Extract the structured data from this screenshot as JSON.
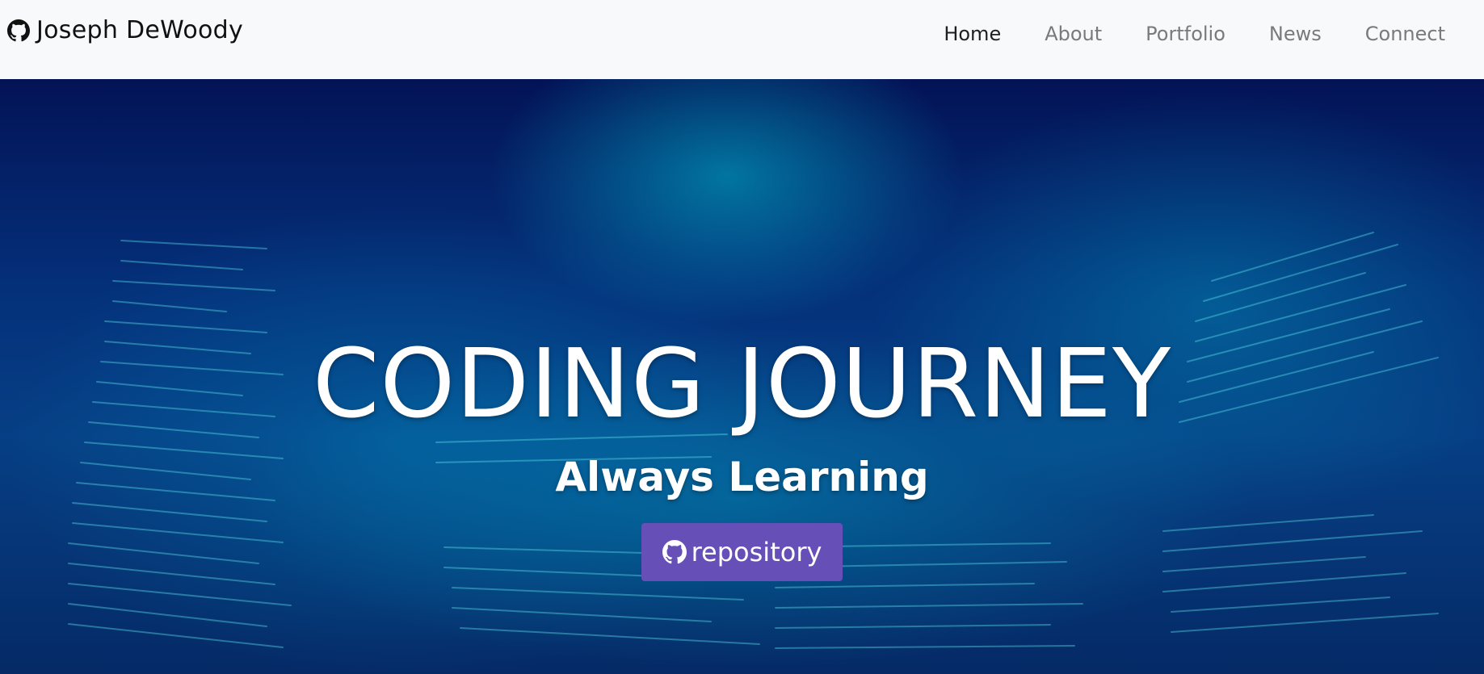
{
  "brand": {
    "name": "Joseph DeWoody",
    "icon": "github-icon"
  },
  "nav": {
    "items": [
      {
        "label": "Home",
        "active": true
      },
      {
        "label": "About",
        "active": false
      },
      {
        "label": "Portfolio",
        "active": false
      },
      {
        "label": "News",
        "active": false
      },
      {
        "label": "Connect",
        "active": false
      }
    ]
  },
  "hero": {
    "title": "CODING JOURNEY",
    "subtitle": "Always Learning",
    "button": {
      "label": "repository",
      "icon": "github-icon"
    }
  },
  "colors": {
    "navbar_bg": "#f8f9fa",
    "nav_active": "#1f1f1f",
    "nav_inactive": "#7a7a7a",
    "button_bg": "#6650b8",
    "hero_text": "#ffffff"
  }
}
